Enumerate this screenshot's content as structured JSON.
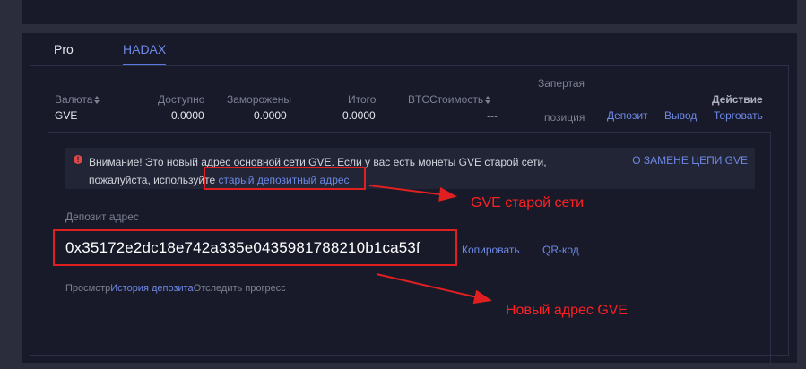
{
  "tabs": [
    {
      "label": "Pro",
      "active": false
    },
    {
      "label": "HADAX",
      "active": true
    }
  ],
  "columns": {
    "currency": "Валюта",
    "available": "Доступно",
    "frozen": "Заморожены",
    "total": "Итого",
    "btc_value": "BTCСтоимость",
    "locked_line1": "Запертая",
    "locked_line2": "позиция",
    "action": "Действие"
  },
  "row": {
    "currency": "GVE",
    "available": "0.0000",
    "frozen": "0.0000",
    "total": "0.0000",
    "btc_value": "---"
  },
  "actions": {
    "deposit": "Депозит",
    "withdraw": "Вывод",
    "trade": "Торговать"
  },
  "warning": {
    "icon": "exclamation-icon",
    "text": "Внимание! Это новый адрес основной сети GVE. Если у вас есть монеты GVE старой сети, пожалуйста, используйте ",
    "link": "старый депозитный адрес",
    "chain_link": "О ЗАМЕНЕ ЦЕПИ GVE"
  },
  "deposit": {
    "address_label": "Депозит адрес",
    "address": "0x35172e2dc18e742a335e0435981788210b1ca53f",
    "copy": "Копировать",
    "qr": "QR-код"
  },
  "view": {
    "prefix": "Просмотр",
    "history": "История депозита",
    "track": "Отследить прогресс"
  },
  "annotations": {
    "old_network": "GVE старой сети",
    "new_address": "Новый адрес GVE"
  },
  "colors": {
    "accent": "#6d89e6",
    "annotation": "#e02020",
    "warning_icon": "#e04848"
  }
}
